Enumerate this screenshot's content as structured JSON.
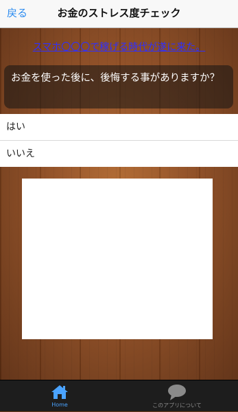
{
  "navbar": {
    "back_label": "戻る",
    "title": "お金のストレス度チェック"
  },
  "link_text": "スマホ〇〇〇で稼げる時代が遂に来た。",
  "question": "お金を使った後に、後悔する事がありますか？",
  "answers": [
    "はい",
    "いいえ"
  ],
  "tabs": [
    {
      "label": "Home",
      "icon": "home-icon",
      "active": true
    },
    {
      "label": "このアプリについて",
      "icon": "speech-bubble-icon",
      "active": false
    }
  ],
  "colors": {
    "accent": "#2d8cf0",
    "link": "#2f2fff",
    "tab_active": "#4aa3ff",
    "tab_inactive": "#8a8a8a"
  }
}
